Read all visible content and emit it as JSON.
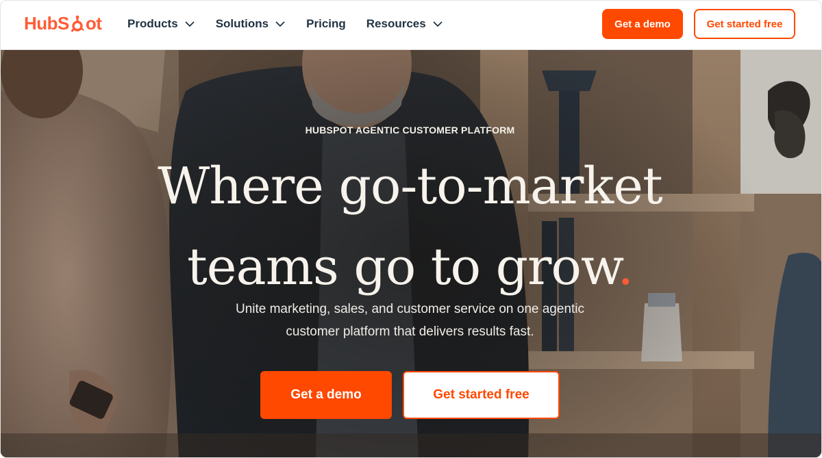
{
  "brand": {
    "logo_text_left": "HubS",
    "logo_text_right": "ot",
    "accent_color": "#ff4800",
    "logo_color": "#ff5c35",
    "text_dark": "#213343"
  },
  "nav": {
    "items": [
      {
        "label": "Products",
        "has_dropdown": true
      },
      {
        "label": "Solutions",
        "has_dropdown": true
      },
      {
        "label": "Pricing",
        "has_dropdown": false
      },
      {
        "label": "Resources",
        "has_dropdown": true
      }
    ]
  },
  "header_actions": {
    "demo_label": "Get a demo",
    "free_label": "Get started free"
  },
  "hero": {
    "eyebrow": "HUBSPOT AGENTIC CUSTOMER PLATFORM",
    "headline_line1": "Where go-to-market",
    "headline_line2": "teams go to grow",
    "headline_punct": ".",
    "subtext_line1": "Unite marketing, sales, and customer service on one agentic",
    "subtext_line2": "customer platform that delivers results fast.",
    "primary_cta": "Get a demo",
    "secondary_cta": "Get started free"
  }
}
